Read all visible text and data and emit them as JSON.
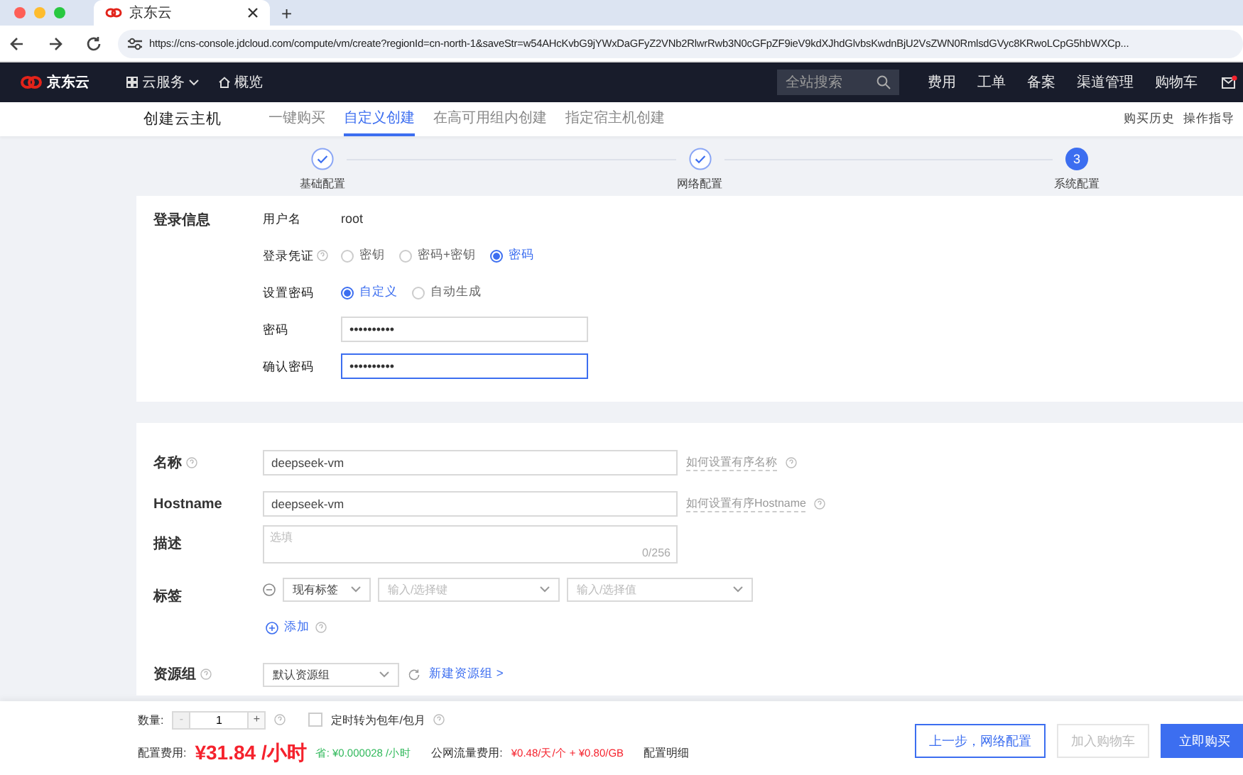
{
  "browser": {
    "tab_title": "京东云",
    "new_tab": "+",
    "url": "https://cns-console.jdcloud.com/compute/vm/create?regionId=cn-north-1&saveStr=w54AHcKvbG9jYWxDaGFyZ2VNb2RlwrRwb3N0cGFpZF9ieV9kdXJhdGlvbsKwdnBjU2VsZWN0RmlsdGVyc8KRwoLCpG5hbWXCp..."
  },
  "nav": {
    "logo": "京东云",
    "menu": [
      {
        "label": "云服务",
        "kind": "dropdown"
      },
      {
        "label": "概览",
        "kind": "home"
      }
    ],
    "search_placeholder": "全站搜索",
    "links": [
      "费用",
      "工单",
      "备案",
      "渠道管理",
      "购物车"
    ]
  },
  "subheader": {
    "title": "创建云主机",
    "tabs": [
      {
        "label": "一键购买",
        "selected": false
      },
      {
        "label": "自定义创建",
        "selected": true
      },
      {
        "label": "在高可用组内创建",
        "selected": false
      },
      {
        "label": "指定宿主机创建",
        "selected": false
      }
    ],
    "links": [
      "购买历史",
      "操作指导"
    ]
  },
  "steps": [
    {
      "label": "基础配置",
      "done": true
    },
    {
      "label": "网络配置",
      "done": true
    },
    {
      "label": "系统配置",
      "done": false,
      "number": "3"
    }
  ],
  "login": {
    "section": "登录信息",
    "rows": [
      {
        "kind": "text",
        "label": "用户名",
        "value": "root"
      },
      {
        "kind": "radio",
        "label": "登录凭证",
        "help": true,
        "options": [
          {
            "label": "密钥",
            "selected": false
          },
          {
            "label": "密码+密钥",
            "selected": false
          },
          {
            "label": "密码",
            "selected": true
          }
        ]
      },
      {
        "kind": "radio",
        "label": "设置密码",
        "help": false,
        "options": [
          {
            "label": "自定义",
            "selected": true
          },
          {
            "label": "自动生成",
            "selected": false
          }
        ]
      },
      {
        "kind": "password",
        "label": "密码",
        "value": "••••••••••",
        "focused": false
      },
      {
        "kind": "password",
        "label": "确认密码",
        "value": "••••••••••",
        "focused": true
      }
    ]
  },
  "instance": {
    "rows": [
      {
        "kind": "input",
        "label": "名称",
        "help": true,
        "value": "deepseek-vm",
        "link": "如何设置有序名称"
      },
      {
        "kind": "input",
        "label": "Hostname",
        "help": false,
        "value": "deepseek-vm",
        "link": "如何设置有序Hostname"
      },
      {
        "kind": "textarea",
        "label": "描述",
        "help": false,
        "placeholder": "选填",
        "counter": "0/256"
      },
      {
        "kind": "tags",
        "label": "标签",
        "help": false,
        "selects": [
          {
            "value": "现有标签"
          },
          {
            "placeholder": "输入/选择键"
          },
          {
            "placeholder": "输入/选择值"
          }
        ],
        "add": "添加"
      },
      {
        "kind": "select",
        "label": "资源组",
        "help": true,
        "value": "默认资源组",
        "link": "新建资源组 >"
      }
    ]
  },
  "footer": {
    "quantity_label": "数量:",
    "minus": "-",
    "quantity": "1",
    "plus": "+",
    "auto_renew": {
      "label": "定时转为包年/包月",
      "checked": false
    },
    "cost_label": "配置费用:",
    "price": "¥31.84 /小时",
    "saving": "省: ¥0.000028 /小时",
    "traffic_label": "公网流量费用:",
    "traffic_price": "¥0.48/天/个 + ¥0.80/GB",
    "details": "配置明细",
    "buttons": [
      {
        "label": "上一步，网络配置",
        "kind": "outline"
      },
      {
        "label": "加入购物车",
        "kind": "disabled"
      },
      {
        "label": "立即购买",
        "kind": "primary"
      }
    ]
  }
}
